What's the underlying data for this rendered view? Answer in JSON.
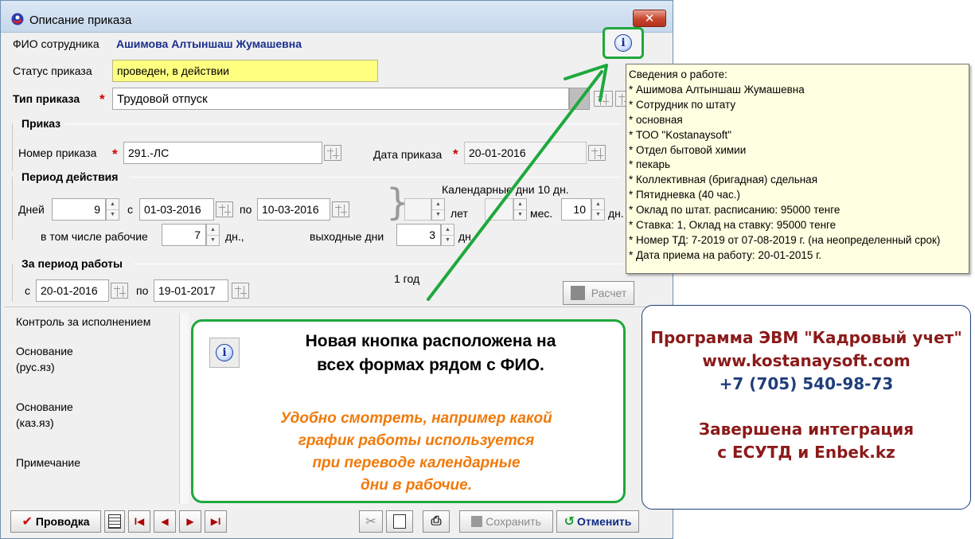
{
  "window": {
    "title": "Описание приказа",
    "close_glyph": "✕"
  },
  "form": {
    "employee_label": "ФИО сотрудника",
    "employee_value": "Ашимова Алтыншаш Жумашевна",
    "status_label": "Статус приказа",
    "status_value": "проведен, в действии",
    "type_label": "Тип приказа",
    "type_value": "Трудовой отпуск",
    "required_mark": "*",
    "order_group": "Приказ",
    "order_number_label": "Номер приказа",
    "order_number_value": "291.-ЛС",
    "order_date_label": "Дата приказа",
    "order_date_value": "20-01-2016",
    "period_group": "Период действия",
    "days_label": "Дней",
    "days_value": "9",
    "from_label": "с",
    "from_value": "01-03-2016",
    "to_label": "по",
    "to_value": "10-03-2016",
    "calendar_days_text": "Календарные дни 10 дн.",
    "years_label": "лет",
    "years_value": "",
    "months_label": "мес.",
    "months_value": "",
    "cal_days_value": "10",
    "cal_days_unit": "дн.",
    "workdays_label": "в том числе рабочие",
    "workdays_value": "7",
    "workdays_unit": "дн.,",
    "weekends_label": "выходные дни",
    "weekends_value": "3",
    "weekends_unit": "дн.",
    "work_period_group": "За период работы",
    "wp_from_label": "с",
    "wp_from_value": "20-01-2016",
    "wp_to_label": "по",
    "wp_to_value": "19-01-2017",
    "wp_duration": "1 год",
    "calc_button": "Расчет",
    "control_label": "Контроль за исполнением",
    "basis_ru_label_1": "Основание",
    "basis_ru_label_2": "(рус.яз)",
    "basis_kz_label_1": "Основание",
    "basis_kz_label_2": "(каз.яз)",
    "note_label": "Примечание"
  },
  "tooltip": {
    "lines": [
      "Сведения о работе:",
      "* Ашимова Алтыншаш Жумашевна",
      "* Сотрудник по штату",
      "* основная",
      "* ТОО \"Kostanaysoft\"",
      "* Отдел бытовой химии",
      "* пекарь",
      "* Коллективная (бригадная) сдельная",
      "* Пятидневка (40 час.)",
      "* Оклад по штат. расписанию: 95000 тенге",
      "* Ставка: 1, Оклад на ставку: 95000 тенге",
      "* Номер ТД: 7-2019 от 07-08-2019 г. (на неопределенный срок)",
      "* Дата приема на работу: 20-01-2015 г."
    ]
  },
  "toolbar": {
    "post_button": "Проводка",
    "post_glyph": "✔",
    "save_button": "Сохранить",
    "cancel_button": "Отменить",
    "nav_first": "I◀",
    "nav_prev": "◀",
    "nav_next": "▶",
    "nav_last": "▶I"
  },
  "callout": {
    "title_line1": "Новая кнопка расположена на",
    "title_line2": "всех формах рядом с ФИО.",
    "note_line1": "Удобно смотреть, например какой",
    "note_line2": "график работы используется",
    "note_line3": "при переводе календарные",
    "note_line4": "дни в рабочие."
  },
  "ad": {
    "line1": "Программа ЭВМ \"Кадровый учет\"",
    "line2": "www.kostanaysoft.com",
    "line3": "+7 (705) 540-98-73",
    "line4": "Завершена интеграция",
    "line5": "с ЕСУТД и Enbek.kz"
  },
  "icons": {
    "info": "i",
    "app": "app-logo-icon"
  },
  "colors": {
    "accent_green": "#1fa83d",
    "status_yellow": "#ffff80",
    "name_blue": "#1a2f8f",
    "required_red": "#d00000",
    "note_orange": "#f07a0a",
    "ad_red": "#8b1a1a",
    "ad_blue": "#1f3e7a"
  }
}
